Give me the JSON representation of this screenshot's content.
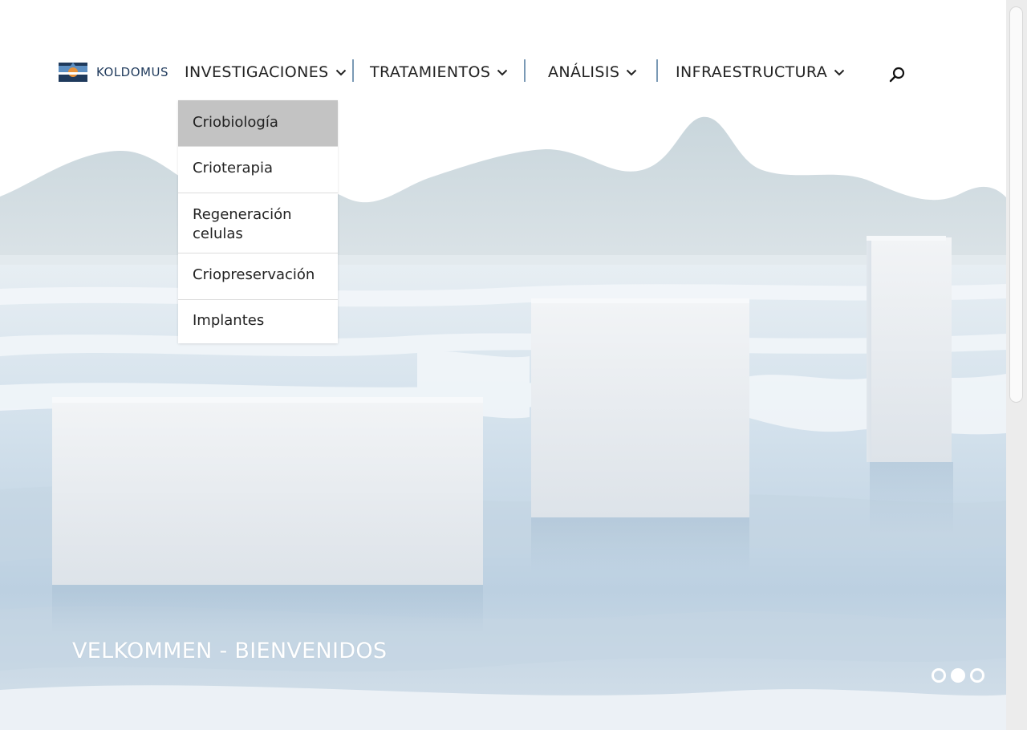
{
  "brand": {
    "name": "KOLDOMUS"
  },
  "nav": {
    "items": [
      {
        "label": "INVESTIGACIONES"
      },
      {
        "label": "TRATAMIENTOS"
      },
      {
        "label": "ANÁLISIS"
      },
      {
        "label": "INFRAESTRUCTURA"
      }
    ]
  },
  "dropdown": {
    "items": [
      {
        "label": "Criobiología",
        "active": true
      },
      {
        "label": "Crioterapia"
      },
      {
        "label": "Regeneración celulas"
      },
      {
        "label": "Criopreservación"
      },
      {
        "label": "Implantes"
      }
    ]
  },
  "hero": {
    "title": "VELKOMMEN - BIENVENIDOS",
    "slide_count": 3,
    "active_slide": 2
  },
  "icons": {
    "search": "search-icon",
    "chevron": "chevron-down-icon",
    "logo": "logo-icon"
  },
  "colors": {
    "brand_dark": "#1f3a5c",
    "brand_orange": "#e8923a",
    "dropdown_active": "#c3c3c3",
    "separator": "#7a99b5"
  }
}
